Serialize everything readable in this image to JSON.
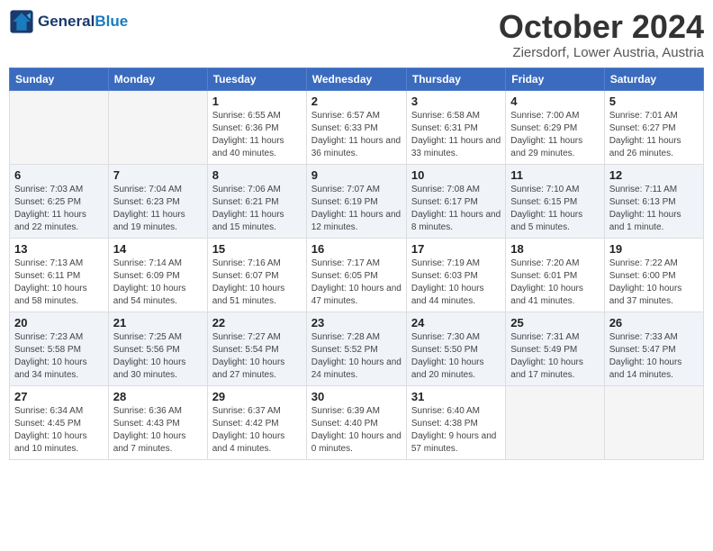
{
  "header": {
    "logo_line1": "General",
    "logo_line2": "Blue",
    "month_title": "October 2024",
    "subtitle": "Ziersdorf, Lower Austria, Austria"
  },
  "days_of_week": [
    "Sunday",
    "Monday",
    "Tuesday",
    "Wednesday",
    "Thursday",
    "Friday",
    "Saturday"
  ],
  "weeks": [
    [
      {
        "day": "",
        "info": ""
      },
      {
        "day": "",
        "info": ""
      },
      {
        "day": "1",
        "info": "Sunrise: 6:55 AM\nSunset: 6:36 PM\nDaylight: 11 hours and 40 minutes."
      },
      {
        "day": "2",
        "info": "Sunrise: 6:57 AM\nSunset: 6:33 PM\nDaylight: 11 hours and 36 minutes."
      },
      {
        "day": "3",
        "info": "Sunrise: 6:58 AM\nSunset: 6:31 PM\nDaylight: 11 hours and 33 minutes."
      },
      {
        "day": "4",
        "info": "Sunrise: 7:00 AM\nSunset: 6:29 PM\nDaylight: 11 hours and 29 minutes."
      },
      {
        "day": "5",
        "info": "Sunrise: 7:01 AM\nSunset: 6:27 PM\nDaylight: 11 hours and 26 minutes."
      }
    ],
    [
      {
        "day": "6",
        "info": "Sunrise: 7:03 AM\nSunset: 6:25 PM\nDaylight: 11 hours and 22 minutes."
      },
      {
        "day": "7",
        "info": "Sunrise: 7:04 AM\nSunset: 6:23 PM\nDaylight: 11 hours and 19 minutes."
      },
      {
        "day": "8",
        "info": "Sunrise: 7:06 AM\nSunset: 6:21 PM\nDaylight: 11 hours and 15 minutes."
      },
      {
        "day": "9",
        "info": "Sunrise: 7:07 AM\nSunset: 6:19 PM\nDaylight: 11 hours and 12 minutes."
      },
      {
        "day": "10",
        "info": "Sunrise: 7:08 AM\nSunset: 6:17 PM\nDaylight: 11 hours and 8 minutes."
      },
      {
        "day": "11",
        "info": "Sunrise: 7:10 AM\nSunset: 6:15 PM\nDaylight: 11 hours and 5 minutes."
      },
      {
        "day": "12",
        "info": "Sunrise: 7:11 AM\nSunset: 6:13 PM\nDaylight: 11 hours and 1 minute."
      }
    ],
    [
      {
        "day": "13",
        "info": "Sunrise: 7:13 AM\nSunset: 6:11 PM\nDaylight: 10 hours and 58 minutes."
      },
      {
        "day": "14",
        "info": "Sunrise: 7:14 AM\nSunset: 6:09 PM\nDaylight: 10 hours and 54 minutes."
      },
      {
        "day": "15",
        "info": "Sunrise: 7:16 AM\nSunset: 6:07 PM\nDaylight: 10 hours and 51 minutes."
      },
      {
        "day": "16",
        "info": "Sunrise: 7:17 AM\nSunset: 6:05 PM\nDaylight: 10 hours and 47 minutes."
      },
      {
        "day": "17",
        "info": "Sunrise: 7:19 AM\nSunset: 6:03 PM\nDaylight: 10 hours and 44 minutes."
      },
      {
        "day": "18",
        "info": "Sunrise: 7:20 AM\nSunset: 6:01 PM\nDaylight: 10 hours and 41 minutes."
      },
      {
        "day": "19",
        "info": "Sunrise: 7:22 AM\nSunset: 6:00 PM\nDaylight: 10 hours and 37 minutes."
      }
    ],
    [
      {
        "day": "20",
        "info": "Sunrise: 7:23 AM\nSunset: 5:58 PM\nDaylight: 10 hours and 34 minutes."
      },
      {
        "day": "21",
        "info": "Sunrise: 7:25 AM\nSunset: 5:56 PM\nDaylight: 10 hours and 30 minutes."
      },
      {
        "day": "22",
        "info": "Sunrise: 7:27 AM\nSunset: 5:54 PM\nDaylight: 10 hours and 27 minutes."
      },
      {
        "day": "23",
        "info": "Sunrise: 7:28 AM\nSunset: 5:52 PM\nDaylight: 10 hours and 24 minutes."
      },
      {
        "day": "24",
        "info": "Sunrise: 7:30 AM\nSunset: 5:50 PM\nDaylight: 10 hours and 20 minutes."
      },
      {
        "day": "25",
        "info": "Sunrise: 7:31 AM\nSunset: 5:49 PM\nDaylight: 10 hours and 17 minutes."
      },
      {
        "day": "26",
        "info": "Sunrise: 7:33 AM\nSunset: 5:47 PM\nDaylight: 10 hours and 14 minutes."
      }
    ],
    [
      {
        "day": "27",
        "info": "Sunrise: 6:34 AM\nSunset: 4:45 PM\nDaylight: 10 hours and 10 minutes."
      },
      {
        "day": "28",
        "info": "Sunrise: 6:36 AM\nSunset: 4:43 PM\nDaylight: 10 hours and 7 minutes."
      },
      {
        "day": "29",
        "info": "Sunrise: 6:37 AM\nSunset: 4:42 PM\nDaylight: 10 hours and 4 minutes."
      },
      {
        "day": "30",
        "info": "Sunrise: 6:39 AM\nSunset: 4:40 PM\nDaylight: 10 hours and 0 minutes."
      },
      {
        "day": "31",
        "info": "Sunrise: 6:40 AM\nSunset: 4:38 PM\nDaylight: 9 hours and 57 minutes."
      },
      {
        "day": "",
        "info": ""
      },
      {
        "day": "",
        "info": ""
      }
    ]
  ]
}
